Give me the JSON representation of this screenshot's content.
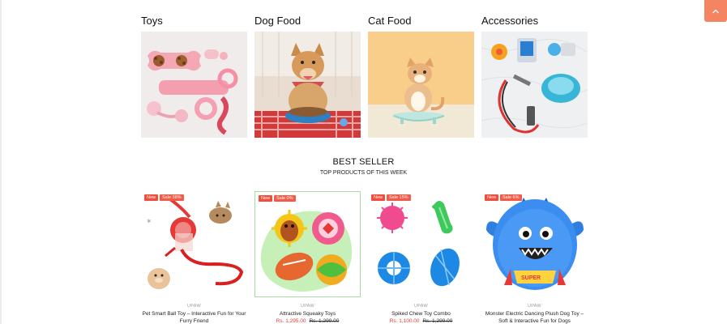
{
  "categories": [
    {
      "title": "Toys"
    },
    {
      "title": "Dog Food"
    },
    {
      "title": "Cat Food"
    },
    {
      "title": "Accessories"
    }
  ],
  "best_seller": {
    "title": "BEST SELLER",
    "subtitle": "TOP PRODUCTS OF THIS WEEK"
  },
  "products": [
    {
      "badge_new": "New",
      "badge_sale": "Sale 38%",
      "vendor": "UPAW",
      "name": "Pet Smart Ball Toy – Interactive Fun for Your Furry Friend",
      "price": "",
      "old_price": ""
    },
    {
      "badge_new": "New",
      "badge_sale": "Sale 0%",
      "vendor": "UPAW",
      "name": "Attractive Squeaky Toys",
      "price": "Rs. 1,295.00",
      "old_price": "Rs. 1,299.00"
    },
    {
      "badge_new": "New",
      "badge_sale": "Sale 15%",
      "vendor": "UPAW",
      "name": "Spiked Chew Toy Combo",
      "price": "Rs. 1,100.00",
      "old_price": "Rs. 1,299.00"
    },
    {
      "badge_new": "New",
      "badge_sale": "Sale 6%",
      "vendor": "UPAW",
      "name": "Monster Electric Dancing Plush Dog Toy – Soft & Interactive Fun for Dogs",
      "price": "",
      "old_price": ""
    }
  ],
  "scroll_top": {
    "icon": "chevron-up-icon"
  },
  "colors": {
    "accent": "#f58463",
    "sale": "#ef4e3c",
    "price": "#e53935"
  }
}
